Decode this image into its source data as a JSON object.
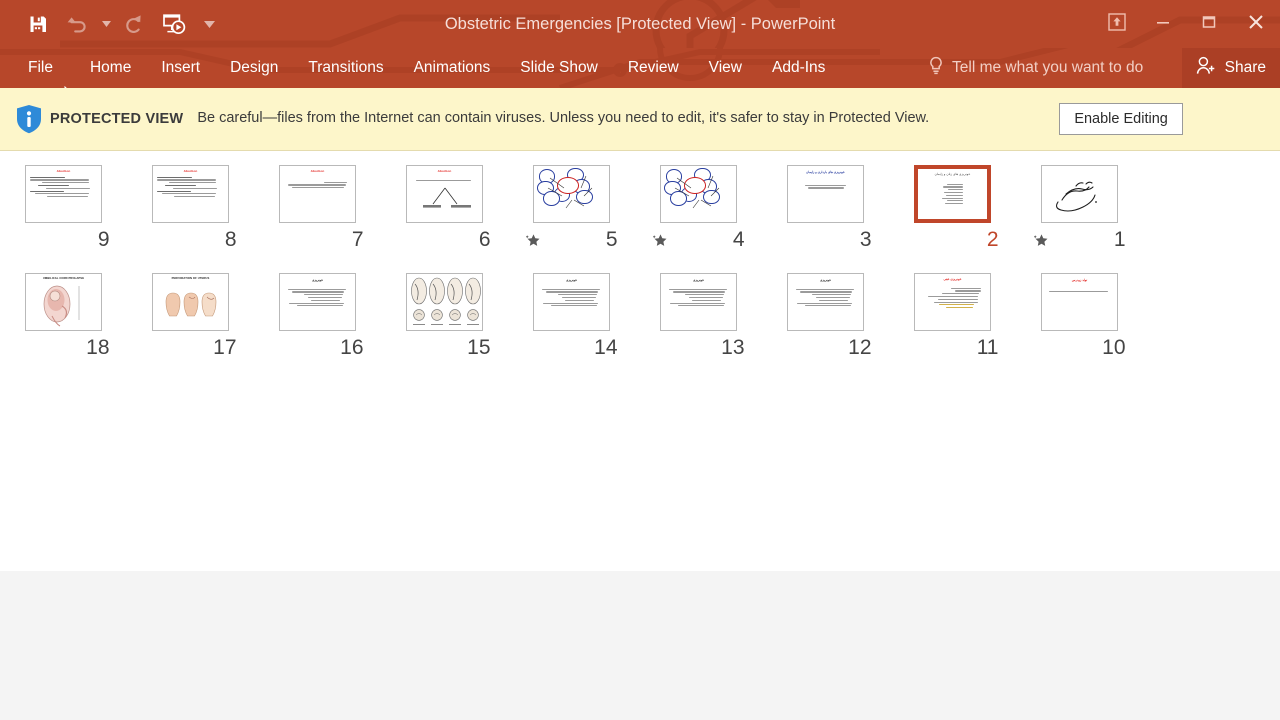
{
  "window": {
    "title": "Obstetric Emergencies [Protected View] - PowerPoint",
    "accent_color": "#b7472a",
    "share_label": "Share"
  },
  "quick_access": {
    "items": [
      {
        "name": "save-button",
        "icon": "save-icon",
        "label": "Save"
      },
      {
        "name": "undo-button",
        "icon": "undo-icon",
        "label": "Undo"
      },
      {
        "name": "redo-button",
        "icon": "redo-icon",
        "label": "Redo"
      },
      {
        "name": "start-slideshow-button",
        "icon": "slideshow-icon",
        "label": "Start From Beginning"
      },
      {
        "name": "customize-qat-button",
        "icon": "chevron-down-icon",
        "label": "Customize Quick Access Toolbar"
      }
    ]
  },
  "window_controls": {
    "ribbon_display_options": "Ribbon Display Options",
    "minimize": "Minimize",
    "maximize": "Restore Down",
    "close": "Close"
  },
  "ribbon": {
    "tabs": [
      {
        "label": "File"
      },
      {
        "label": "Home"
      },
      {
        "label": "Insert"
      },
      {
        "label": "Design"
      },
      {
        "label": "Transitions"
      },
      {
        "label": "Animations"
      },
      {
        "label": "Slide Show"
      },
      {
        "label": "Review"
      },
      {
        "label": "View"
      },
      {
        "label": "Add-Ins"
      }
    ],
    "tell_me": "Tell me what you want to do"
  },
  "protected_view": {
    "label": "PROTECTED VIEW",
    "message": "Be careful—files from the Internet can contain viruses. Unless you need to edit, it's safer to stay in Protected View.",
    "enable_button": "Enable Editing",
    "background_color": "#fdf6ca",
    "icon": "info-shield-icon"
  },
  "slide_sorter": {
    "selected_slide": 2,
    "selection_color": "#c0462a",
    "rows": [
      [
        {
          "number": "9",
          "animated": false,
          "selected": false,
          "title": "Abortion",
          "title_color": "red",
          "kind": "text-red"
        },
        {
          "number": "8",
          "animated": false,
          "selected": false,
          "title": "Abortion",
          "title_color": "red",
          "kind": "text-red"
        },
        {
          "number": "7",
          "animated": false,
          "selected": false,
          "title": "Abortion",
          "title_color": "red",
          "kind": "text-sparse"
        },
        {
          "number": "6",
          "animated": false,
          "selected": false,
          "title": "Abortion",
          "title_color": "red",
          "kind": "tree"
        },
        {
          "number": "5",
          "animated": true,
          "selected": false,
          "title": "",
          "title_color": "red",
          "kind": "clouds"
        },
        {
          "number": "4",
          "animated": true,
          "selected": false,
          "title": "",
          "title_color": "red",
          "kind": "clouds"
        },
        {
          "number": "3",
          "animated": false,
          "selected": false,
          "title": "",
          "title_color": "blue",
          "kind": "text-blue"
        },
        {
          "number": "2",
          "animated": false,
          "selected": true,
          "title": "",
          "title_color": "dark",
          "kind": "text-rtl"
        },
        {
          "number": "1",
          "animated": true,
          "selected": false,
          "title": "",
          "title_color": "dark",
          "kind": "calligraphy"
        }
      ],
      [
        {
          "number": "18",
          "animated": false,
          "selected": false,
          "title": "UMBILICAL CORD PROLAPSE",
          "title_color": "dark",
          "kind": "anatomy-cord"
        },
        {
          "number": "17",
          "animated": false,
          "selected": false,
          "title": "PERFORATION OF UTERUS",
          "title_color": "dark",
          "kind": "anatomy-uterus"
        },
        {
          "number": "16",
          "animated": false,
          "selected": false,
          "title": "",
          "title_color": "dark",
          "kind": "text-dark"
        },
        {
          "number": "15",
          "animated": false,
          "selected": false,
          "title": "",
          "title_color": "dark",
          "kind": "anatomy-grid"
        },
        {
          "number": "14",
          "animated": false,
          "selected": false,
          "title": "",
          "title_color": "dark",
          "kind": "text-dark"
        },
        {
          "number": "13",
          "animated": false,
          "selected": false,
          "title": "",
          "title_color": "dark",
          "kind": "text-dark"
        },
        {
          "number": "12",
          "animated": false,
          "selected": false,
          "title": "",
          "title_color": "dark",
          "kind": "text-dark"
        },
        {
          "number": "11",
          "animated": false,
          "selected": false,
          "title": "",
          "title_color": "red",
          "kind": "text-gold"
        },
        {
          "number": "10",
          "animated": false,
          "selected": false,
          "title": "",
          "title_color": "red",
          "kind": "text-oneline"
        }
      ]
    ]
  }
}
